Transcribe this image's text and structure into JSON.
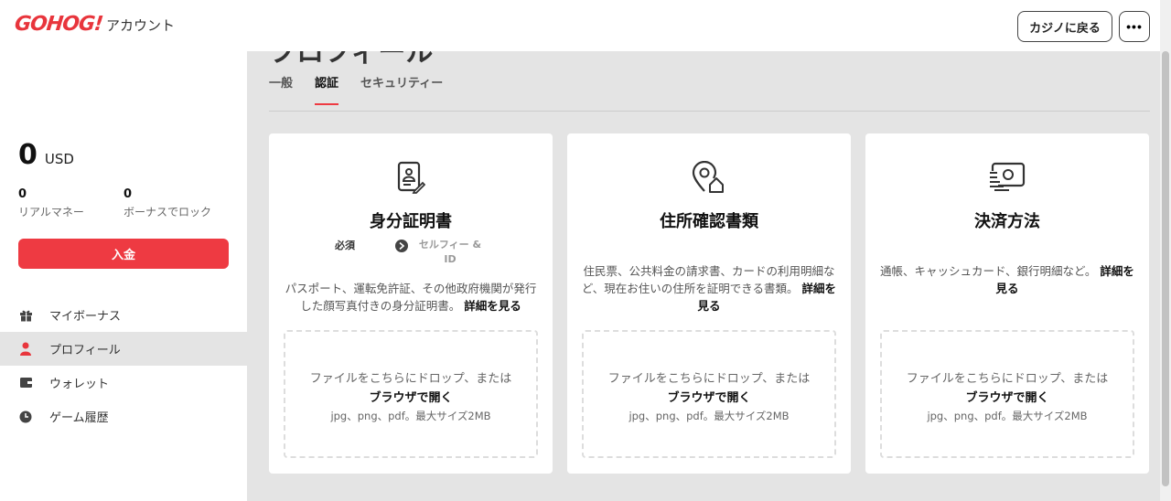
{
  "header": {
    "logo": "GOHOG!",
    "title": "アカウント",
    "back_label": "カジノに戻る",
    "more_label": "•••"
  },
  "sidebar": {
    "balance": {
      "amount": "0",
      "currency": "USD"
    },
    "real_money": {
      "value": "0",
      "label": "リアルマネー"
    },
    "bonus_locked": {
      "value": "0",
      "label": "ボーナスでロック"
    },
    "deposit_label": "入金",
    "nav": [
      {
        "label": "マイボーナス",
        "icon": "gift-icon"
      },
      {
        "label": "プロフィール",
        "icon": "user-icon",
        "active": true
      },
      {
        "label": "ウォレット",
        "icon": "wallet-icon"
      },
      {
        "label": "ゲーム履歴",
        "icon": "clock-icon"
      }
    ]
  },
  "main": {
    "partial_title": "プロフィール",
    "tabs": [
      "一般",
      "認証",
      "セキュリティー"
    ],
    "active_tab": "認証",
    "cards": [
      {
        "icon": "id-document-icon",
        "title": "身分証明書",
        "required": "必須",
        "selfie": "セルフィー & ID",
        "desc": "パスポート、運転免許証、その他政府機関が発行した顔写真付きの身分証明書。",
        "more": "詳細を見る"
      },
      {
        "icon": "location-home-icon",
        "title": "住所確認書類",
        "desc": "住民票、公共料金の請求書、カードの利用明細など、現在お住いの住所を証明できる書類。",
        "more": "詳細を見る"
      },
      {
        "icon": "payment-card-icon",
        "title": "決済方法",
        "desc": "通帳、キャッシュカード、銀行明細など。",
        "more": "詳細を見る"
      }
    ],
    "dropzone": {
      "text": "ファイルをこちらにドロップ、または",
      "browse": "ブラウザで開く",
      "hint": "jpg、png、pdf。最大サイズ2MB"
    }
  },
  "colors": {
    "accent": "#ee3a42",
    "background": "#e4e4e4"
  }
}
